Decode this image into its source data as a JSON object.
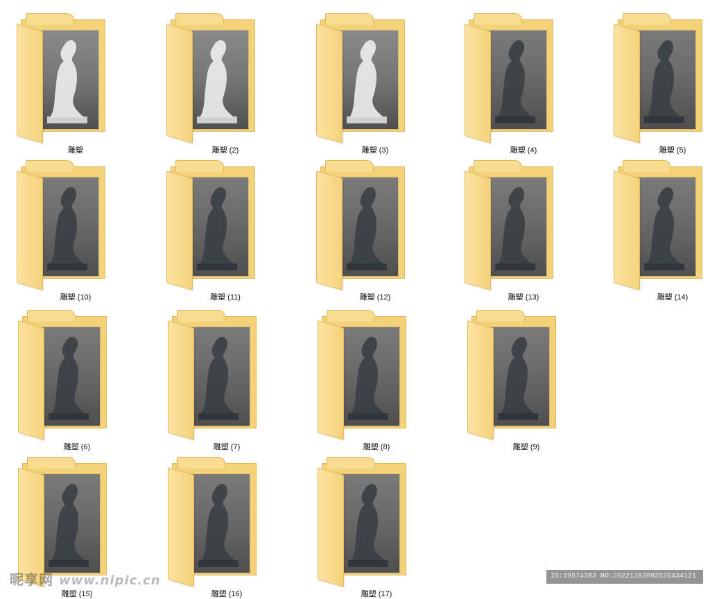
{
  "folders": [
    {
      "label": "雕塑",
      "thumb": "white"
    },
    {
      "label": "雕塑 (2)",
      "thumb": "white"
    },
    {
      "label": "雕塑 (3)",
      "thumb": "white"
    },
    {
      "label": "雕塑 (4)",
      "thumb": "dark"
    },
    {
      "label": "雕塑 (5)",
      "thumb": "dark"
    },
    {
      "label": "雕塑 (10)",
      "thumb": "dark"
    },
    {
      "label": "雕塑 (11)",
      "thumb": "dark"
    },
    {
      "label": "雕塑 (12)",
      "thumb": "dark"
    },
    {
      "label": "雕塑 (13)",
      "thumb": "dark"
    },
    {
      "label": "雕塑 (14)",
      "thumb": "dark"
    },
    {
      "label": "雕塑 (6)",
      "thumb": "dark"
    },
    {
      "label": "雕塑 (7)",
      "thumb": "dark"
    },
    {
      "label": "雕塑 (8)",
      "thumb": "dark"
    },
    {
      "label": "雕塑 (9)",
      "thumb": "dark"
    },
    {
      "label": "雕塑 (15)",
      "thumb": "dark"
    },
    {
      "label": "雕塑 (16)",
      "thumb": "dark"
    },
    {
      "label": "雕塑 (17)",
      "thumb": "dark"
    }
  ],
  "watermark": {
    "site": "昵享网",
    "url": "www.nipic.cn",
    "id_text": "ID:19574383 NO:20221203092526434121"
  }
}
